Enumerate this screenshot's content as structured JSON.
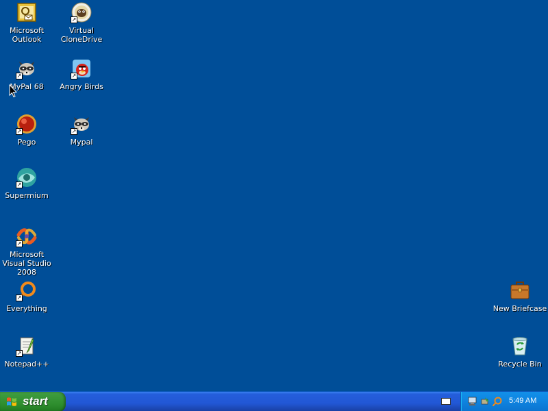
{
  "desktop": {
    "icons": [
      {
        "label": "Microsoft Outlook",
        "name": "outlook"
      },
      {
        "label": "Virtual CloneDrive",
        "name": "virtual-clonedrive"
      },
      {
        "label": "MyPal 68",
        "name": "mypal-68"
      },
      {
        "label": "Angry Birds",
        "name": "angry-birds"
      },
      {
        "label": "Pego",
        "name": "pego"
      },
      {
        "label": "Mypal",
        "name": "mypal"
      },
      {
        "label": "Supermium",
        "name": "supermium"
      },
      {
        "label": "Microsoft Visual Studio 2008",
        "name": "visual-studio-2008"
      },
      {
        "label": "Everything",
        "name": "everything"
      },
      {
        "label": "Notepad++",
        "name": "notepad-plus-plus"
      },
      {
        "label": "New Briefcase",
        "name": "new-briefcase"
      },
      {
        "label": "Recycle Bin",
        "name": "recycle-bin"
      }
    ]
  },
  "taskbar": {
    "start_label": "start",
    "clock": "5:49 AM"
  },
  "colors": {
    "desktop_bg": "#004e98",
    "taskbar": "#245edb",
    "start_green": "#3c9a3c",
    "tray": "#0f86e2"
  }
}
